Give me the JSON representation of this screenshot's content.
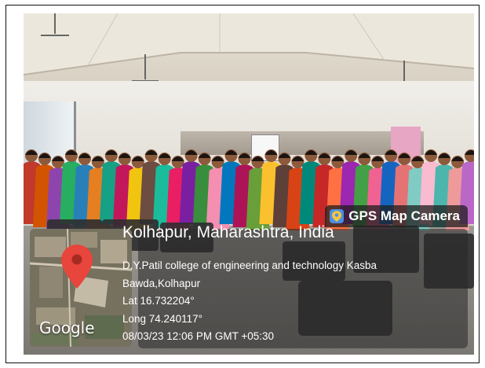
{
  "photo": {
    "scene": "group-photo"
  },
  "overlay": {
    "badge_label": "GPS Map Camera",
    "location_title": "Kolhapur, Maharashtra, India",
    "address_line1": "D.Y.Patil college of engineering and technology Kasba",
    "address_line2": "Bawda,Kolhapur",
    "latitude": "Lat 16.732204°",
    "longitude": "Long 74.240117°",
    "datetime": "08/03/23 12:06 PM GMT +05:30"
  },
  "map": {
    "provider_label": "Google",
    "pin_color": "#e8453c"
  }
}
